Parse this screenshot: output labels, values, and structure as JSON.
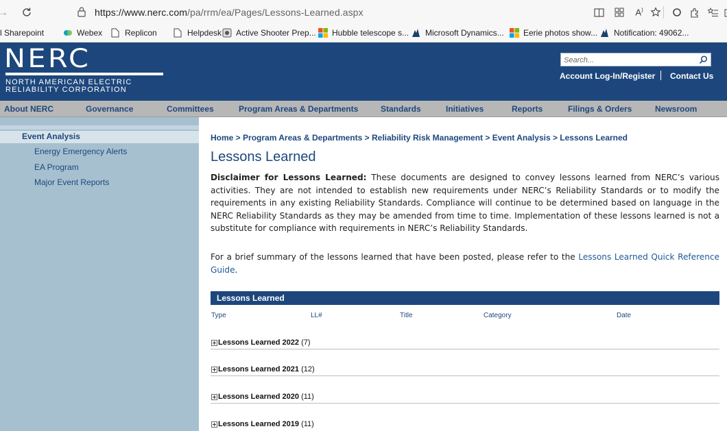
{
  "browser": {
    "url_host": "https://www.nerc.com",
    "url_path": "/pa/rrm/ea/Pages/Lessons-Learned.aspx",
    "favorites": [
      {
        "label": "l Sharepoint"
      },
      {
        "label": "Webex"
      },
      {
        "label": "Replicon"
      },
      {
        "label": "Helpdesk"
      },
      {
        "label": "Active Shooter Prep..."
      },
      {
        "label": "Hubble telescope s..."
      },
      {
        "label": "Microsoft Dynamics..."
      },
      {
        "label": "Eerie photos show..."
      },
      {
        "label": "Notification: 49062..."
      }
    ]
  },
  "header": {
    "logo_text": "NERC",
    "logo_sub_1": "NORTH AMERICAN ELECTRIC",
    "logo_sub_2": "RELIABILITY CORPORATION",
    "search_placeholder": "Search...",
    "account_link": "Account Log-In/Register",
    "contact_link": "Contact Us"
  },
  "nav": [
    {
      "label": "About NERC"
    },
    {
      "label": "Governance"
    },
    {
      "label": "Committees"
    },
    {
      "label": "Program Areas & Departments"
    },
    {
      "label": "Standards"
    },
    {
      "label": "Initiatives"
    },
    {
      "label": "Reports"
    },
    {
      "label": "Filings & Orders"
    },
    {
      "label": "Newsroom"
    }
  ],
  "sidebar": {
    "heading": "Event Analysis",
    "items": [
      {
        "label": "Energy Emergency Alerts"
      },
      {
        "label": "EA Program"
      },
      {
        "label": "Major Event Reports"
      }
    ]
  },
  "main": {
    "breadcrumb": "Home > Program Areas & Departments > Reliability Risk Management > Event Analysis > Lessons Learned",
    "title": "Lessons Learned",
    "disclaimer_label": "Disclaimer for Lessons Learned:",
    "disclaimer_text": " These documents are designed to convey lessons learned from NERC’s various activities. They are not intended to establish new requirements under NERC’s Reliability Standards or to modify the requirements in any existing Reliability Standards. Compliance will continue to be determined based on language in the NERC Reliability Standards as they may be amended from time to time. Implementation of these lessons learned is not a substitute for compliance with requirements in NERC’s Reliability Standards.",
    "summary_text": "For a brief summary of the lessons learned that have been posted, please refer to the ",
    "summary_link": "Lessons Learned Quick Reference Guide",
    "summary_end": ".",
    "table_title": "Lessons Learned",
    "columns": [
      "Type",
      "LL#",
      "Title",
      "Category",
      "Date"
    ],
    "groups": [
      {
        "label": "Lessons Learned 2022",
        "count": "(7)"
      },
      {
        "label": "Lessons Learned 2021",
        "count": "(12)"
      },
      {
        "label": "Lessons Learned 2020",
        "count": "(11)"
      },
      {
        "label": "Lessons Learned 2019",
        "count": "(11)"
      }
    ]
  },
  "colors": {
    "brand_blue": "#1d477c",
    "sidebar_bg": "#a6c0cf",
    "nav_bg": "#b7b7b7"
  }
}
